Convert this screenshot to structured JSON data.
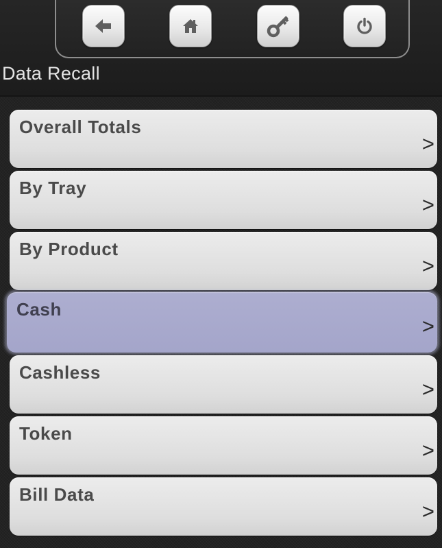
{
  "header": {
    "title": "Data Recall",
    "nav_buttons": [
      {
        "icon": "arrow-left-icon",
        "action": "back"
      },
      {
        "icon": "home-icon",
        "action": "home"
      },
      {
        "icon": "key-icon",
        "action": "service"
      },
      {
        "icon": "power-icon",
        "action": "exit"
      }
    ]
  },
  "menu": {
    "chevron": ">",
    "selected_index": 3,
    "items": [
      {
        "label": "Overall Totals"
      },
      {
        "label": "By Tray"
      },
      {
        "label": "By Product"
      },
      {
        "label": "Cash"
      },
      {
        "label": "Cashless"
      },
      {
        "label": "Token"
      },
      {
        "label": "Bill Data"
      }
    ]
  },
  "colors": {
    "background": "#202020",
    "button_face": "#e6e6e6",
    "selected_highlight": "#a8a9cd",
    "label_text": "#4a4a4a",
    "icon_fill": "#5f5f5f"
  }
}
